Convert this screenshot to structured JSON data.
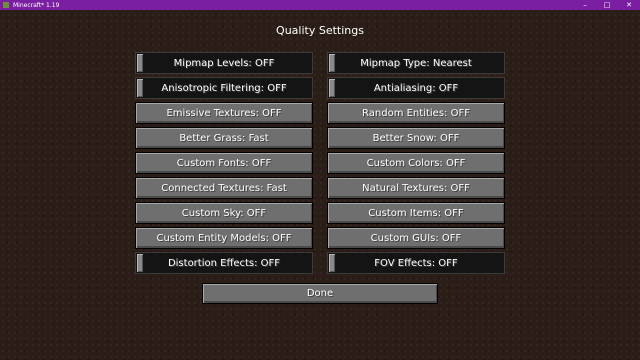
{
  "window": {
    "title": "Minecraft* 1.19",
    "minimize": "–",
    "maximize": "□",
    "close": "✕"
  },
  "screen_title": "Quality Settings",
  "options": [
    {
      "label": "Mipmap Levels: OFF",
      "kind": "slider"
    },
    {
      "label": "Mipmap Type: Nearest",
      "kind": "slider"
    },
    {
      "label": "Anisotropic Filtering: OFF",
      "kind": "slider"
    },
    {
      "label": "Antialiasing: OFF",
      "kind": "slider"
    },
    {
      "label": "Emissive Textures: OFF",
      "kind": "button"
    },
    {
      "label": "Random Entities: OFF",
      "kind": "button"
    },
    {
      "label": "Better Grass: Fast",
      "kind": "button"
    },
    {
      "label": "Better Snow: OFF",
      "kind": "button"
    },
    {
      "label": "Custom Fonts: OFF",
      "kind": "button"
    },
    {
      "label": "Custom Colors: OFF",
      "kind": "button"
    },
    {
      "label": "Connected Textures: Fast",
      "kind": "button"
    },
    {
      "label": "Natural Textures: OFF",
      "kind": "button"
    },
    {
      "label": "Custom Sky: OFF",
      "kind": "button"
    },
    {
      "label": "Custom Items: OFF",
      "kind": "button"
    },
    {
      "label": "Custom Entity Models: OFF",
      "kind": "button"
    },
    {
      "label": "Custom GUIs: OFF",
      "kind": "button"
    },
    {
      "label": "Distortion Effects: OFF",
      "kind": "slider"
    },
    {
      "label": "FOV Effects: OFF",
      "kind": "slider"
    }
  ],
  "done_label": "Done",
  "colors": {
    "titlebar": "#7b1fa2",
    "button": "#6f6f6f",
    "slider_track": "#141414",
    "text": "#ffffff"
  }
}
